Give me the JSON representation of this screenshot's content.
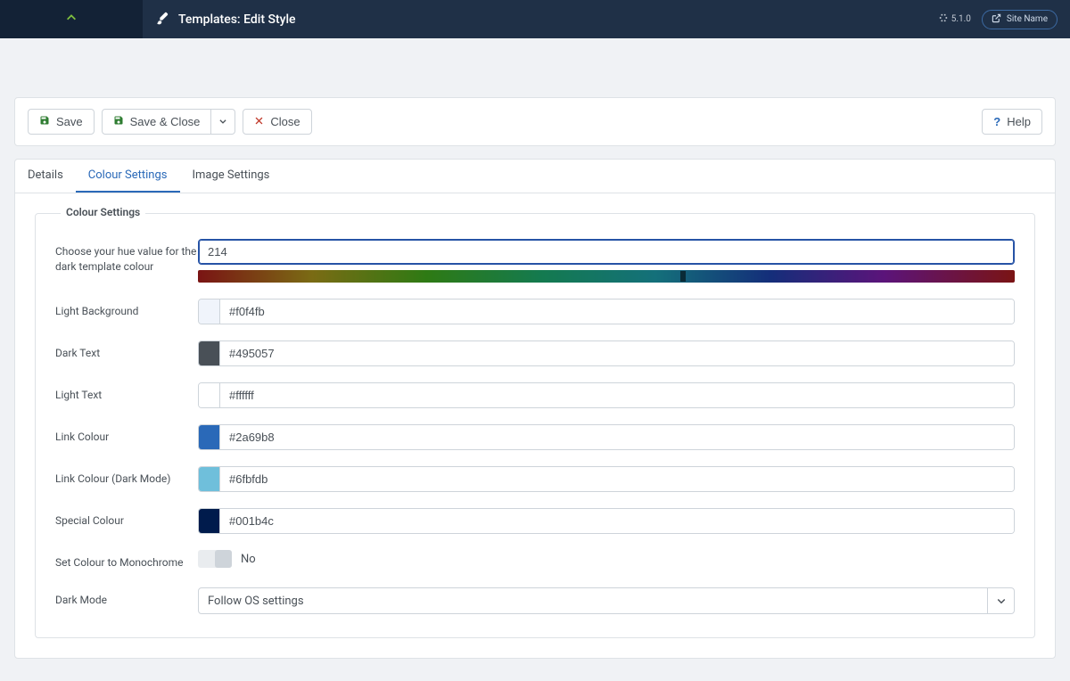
{
  "header": {
    "title": "Templates: Edit Style",
    "version_label": "5.1.0",
    "site_name": "Site Name"
  },
  "toolbar": {
    "save": "Save",
    "save_close": "Save & Close",
    "close": "Close",
    "help": "Help"
  },
  "tabs": [
    {
      "key": "details",
      "label": "Details",
      "active": false
    },
    {
      "key": "colour",
      "label": "Colour Settings",
      "active": true
    },
    {
      "key": "image",
      "label": "Image Settings",
      "active": false
    }
  ],
  "legend": "Colour Settings",
  "fields": {
    "hue": {
      "label": "Choose your hue value for the dark template colour",
      "value": "214",
      "handle_percent": 59.4
    },
    "light_bg": {
      "label": "Light Background",
      "value": "#f0f4fb"
    },
    "dark_text": {
      "label": "Dark Text",
      "value": "#495057"
    },
    "light_text": {
      "label": "Light Text",
      "value": "#ffffff"
    },
    "link": {
      "label": "Link Colour",
      "value": "#2a69b8"
    },
    "link_dark": {
      "label": "Link Colour (Dark Mode)",
      "value": "#6fbfdb"
    },
    "special": {
      "label": "Special Colour",
      "value": "#001b4c"
    },
    "mono": {
      "label": "Set Colour to Monochrome",
      "state_label": "No",
      "on": false
    },
    "dark_mode": {
      "label": "Dark Mode",
      "value": "Follow OS settings"
    }
  }
}
